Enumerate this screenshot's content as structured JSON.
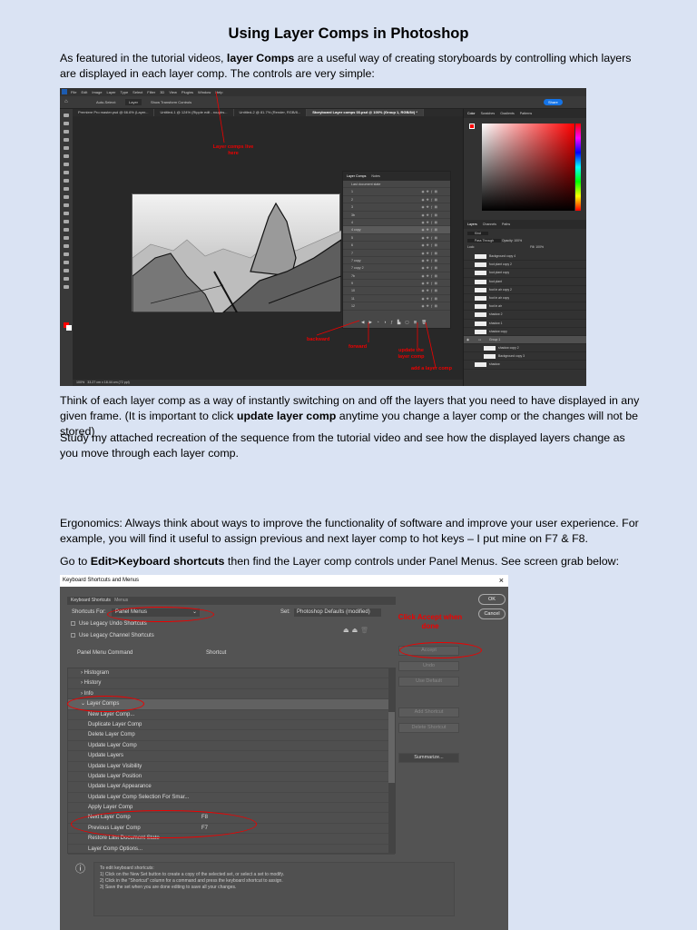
{
  "doc": {
    "title": "Using Layer Comps in Photoshop",
    "p1_a": "As featured in the tutorial videos, ",
    "p1_b": "layer Comps",
    "p1_c": " are a useful way of creating storyboards by controlling which layers are displayed in each layer comp.   The controls are very simple:",
    "p2_a": "Think of each layer comp as a way of instantly switching on and off the layers that you need to have displayed in any given frame. (It is important to click ",
    "p2_b": "update layer comp",
    "p2_c": " anytime you change a layer comp or the changes will not be stored)",
    "p3": "Study my attached recreation of the sequence from the tutorial video and see how the displayed layers change as you move through each layer comp.",
    "p4": "Ergonomics: Always think about ways to improve the functionality of software and improve your user experience.  For example, you will find it useful to assign previous and next layer comp to hot keys – I put mine on F7 & F8.",
    "p5_a": "Go to ",
    "p5_b": "Edit>Keyboard shortcuts",
    "p5_c": " then find the Layer comp controls under Panel Menus. See screen grab below:"
  },
  "ps": {
    "menu": [
      "File",
      "Edit",
      "Image",
      "Layer",
      "Type",
      "Select",
      "Filter",
      "3D",
      "View",
      "Plugins",
      "Window",
      "Help"
    ],
    "options": {
      "autoselect": "Auto-Select:",
      "layer": "Layer",
      "transform": "Show Transform Controls",
      "share": "Share"
    },
    "tabs": [
      "Premiere Pro master.psd @ 66.6% (Layer...",
      "Untitled-1 @ 124% (Ripple edit - roughs...",
      "Untitled-2 @ 81.7% (Render, RGB/8...",
      "Storyboard Layer comps 03.psd @ 100% (Group 1, RGB/8#) *"
    ],
    "status": {
      "zoom": "100%",
      "info": "33.27 cm x 18.44 cm (72 ppi)"
    },
    "layer_comps": {
      "tabs": [
        "Layer Comps",
        "Notes"
      ],
      "rows": [
        "Last document state",
        "1",
        "2",
        "3",
        "3b",
        "4",
        "4 copy",
        "5",
        "6",
        "7",
        "7 copy",
        "7 copy 2",
        "7b",
        "9",
        "10",
        "11",
        "12"
      ],
      "selected": "4 copy"
    },
    "color_tabs": [
      "Color",
      "Swatches",
      "Gradients",
      "Patterns"
    ],
    "layers": {
      "tabs": [
        "Layers",
        "Channels",
        "Paths"
      ],
      "kind": "Kind",
      "blend": "Pass Through",
      "opacity_label": "Opacity:",
      "opacity": "100%",
      "lock_label": "Lock:",
      "fill_label": "Fill:",
      "fill": "100%",
      "rows": [
        "Background copy 4",
        "foot plant copy 2",
        "foot plant copy",
        "foot plant",
        "foot in air copy 2",
        "foot in air copy",
        "foot in air",
        "shadow 2",
        "shadow 1",
        "shadow copy",
        "Group 1",
        "shadow copy 2",
        "Background copy 3",
        "shadow"
      ]
    },
    "annotations": {
      "live": "Layer comps live here",
      "backward": "backward",
      "forward": "forward",
      "update": "update the layer comp",
      "add": "add a layer comp"
    },
    "colors": {
      "annotation": "#e00000",
      "fg": "#ff0000"
    }
  },
  "dlg": {
    "title": "Keyboard Shortcuts and Menus",
    "close": "×",
    "tabs": [
      "Keyboard Shortcuts",
      "Menus"
    ],
    "shortcuts_for_label": "Shortcuts For:",
    "shortcuts_for": "Panel Menus",
    "set_label": "Set:",
    "set": "Photoshop Defaults (modified)",
    "legacy_undo": "Use Legacy Undo Shortcuts",
    "legacy_channel": "Use Legacy Channel Shortcuts",
    "col_command": "Panel Menu Command",
    "col_shortcut": "Shortcut",
    "groups": [
      "Histogram",
      "History",
      "Info"
    ],
    "open_group": "Layer Comps",
    "items": [
      {
        "c": "New Layer Comp...",
        "s": ""
      },
      {
        "c": "Duplicate Layer Comp",
        "s": ""
      },
      {
        "c": "Delete Layer Comp",
        "s": ""
      },
      {
        "c": "Update Layer Comp",
        "s": ""
      },
      {
        "c": "Update Layers",
        "s": ""
      },
      {
        "c": "Update Layer Visibility",
        "s": ""
      },
      {
        "c": "Update Layer Position",
        "s": ""
      },
      {
        "c": "Update Layer Appearance",
        "s": ""
      },
      {
        "c": "Update Layer Comp Selection For Smar...",
        "s": ""
      },
      {
        "c": "Apply Layer Comp",
        "s": ""
      },
      {
        "c": "Next Layer Comp",
        "s": "F8"
      },
      {
        "c": "Previous Layer Comp",
        "s": "F7"
      },
      {
        "c": "Restore Last Document State",
        "s": ""
      },
      {
        "c": "Layer Comp Options...",
        "s": ""
      }
    ],
    "buttons": {
      "ok": "OK",
      "cancel": "Cancel",
      "accept": "Accept",
      "undo": "Undo",
      "use_default": "Use Default",
      "add": "Add Shortcut",
      "delete": "Delete Shortcut",
      "summarize": "Summarize..."
    },
    "annotation": "Click Accept when done",
    "info": [
      "To edit keyboard shortcuts:",
      "1) Click on the New Set button to create a copy of the selected set, or select a set to modify.",
      "2) Click in the \"Shortcut\" column for a command and press the keyboard shortcut to assign.",
      "3) Save the set when you are done editing to save all your changes."
    ]
  }
}
